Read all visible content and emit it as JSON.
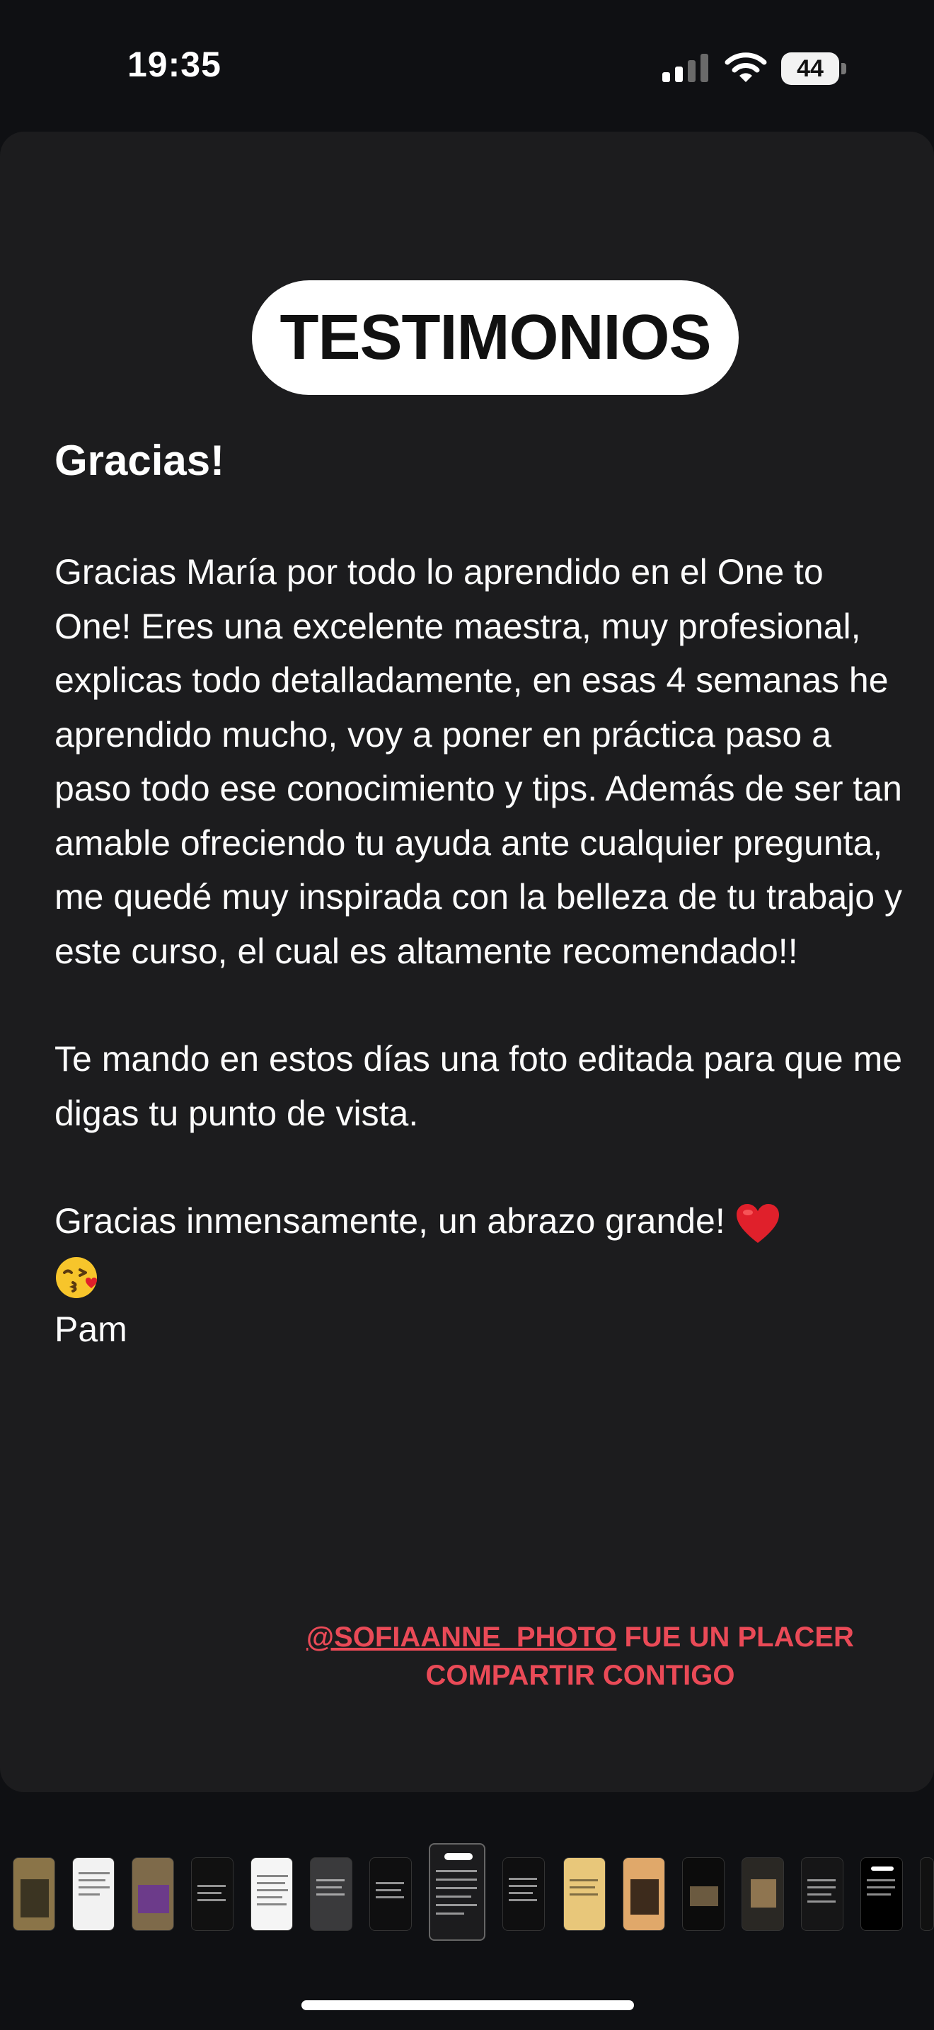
{
  "status_bar": {
    "time": "19:35",
    "battery": "44"
  },
  "story": {
    "title": "TESTIMONIOS",
    "heading": "Gracias!",
    "paragraph1": "Gracias María por todo lo aprendido en el One to One! Eres una excelente maestra, muy profesional, explicas todo detalladamente, en esas 4 semanas he aprendido mucho, voy a poner en práctica paso a paso todo ese conocimiento y tips. Además de ser tan amable ofreciendo tu ayuda ante cualquier pregunta, me quedé muy inspirada con la belleza de tu trabajo y este curso, el cual es altamente recomendado!!",
    "paragraph2": "Te mando en estos días una foto editada para que me digas tu punto de vista.",
    "paragraph3": "Gracias inmensamente, un abrazo grande!",
    "signature": "Pam",
    "credit_handle": "@SOFIAANNE_PHOTO",
    "credit_text_line1": " FUE UN PLACER",
    "credit_text_line2": "COMPARTIR CONTIGO"
  },
  "icons": [
    "signal-icon",
    "wifi-icon",
    "battery-icon",
    "heart-emoji-icon",
    "kiss-emoji-icon"
  ],
  "colors": {
    "background": "#0f1013",
    "card": "#1c1c1e",
    "accent": "#ea4a57"
  }
}
